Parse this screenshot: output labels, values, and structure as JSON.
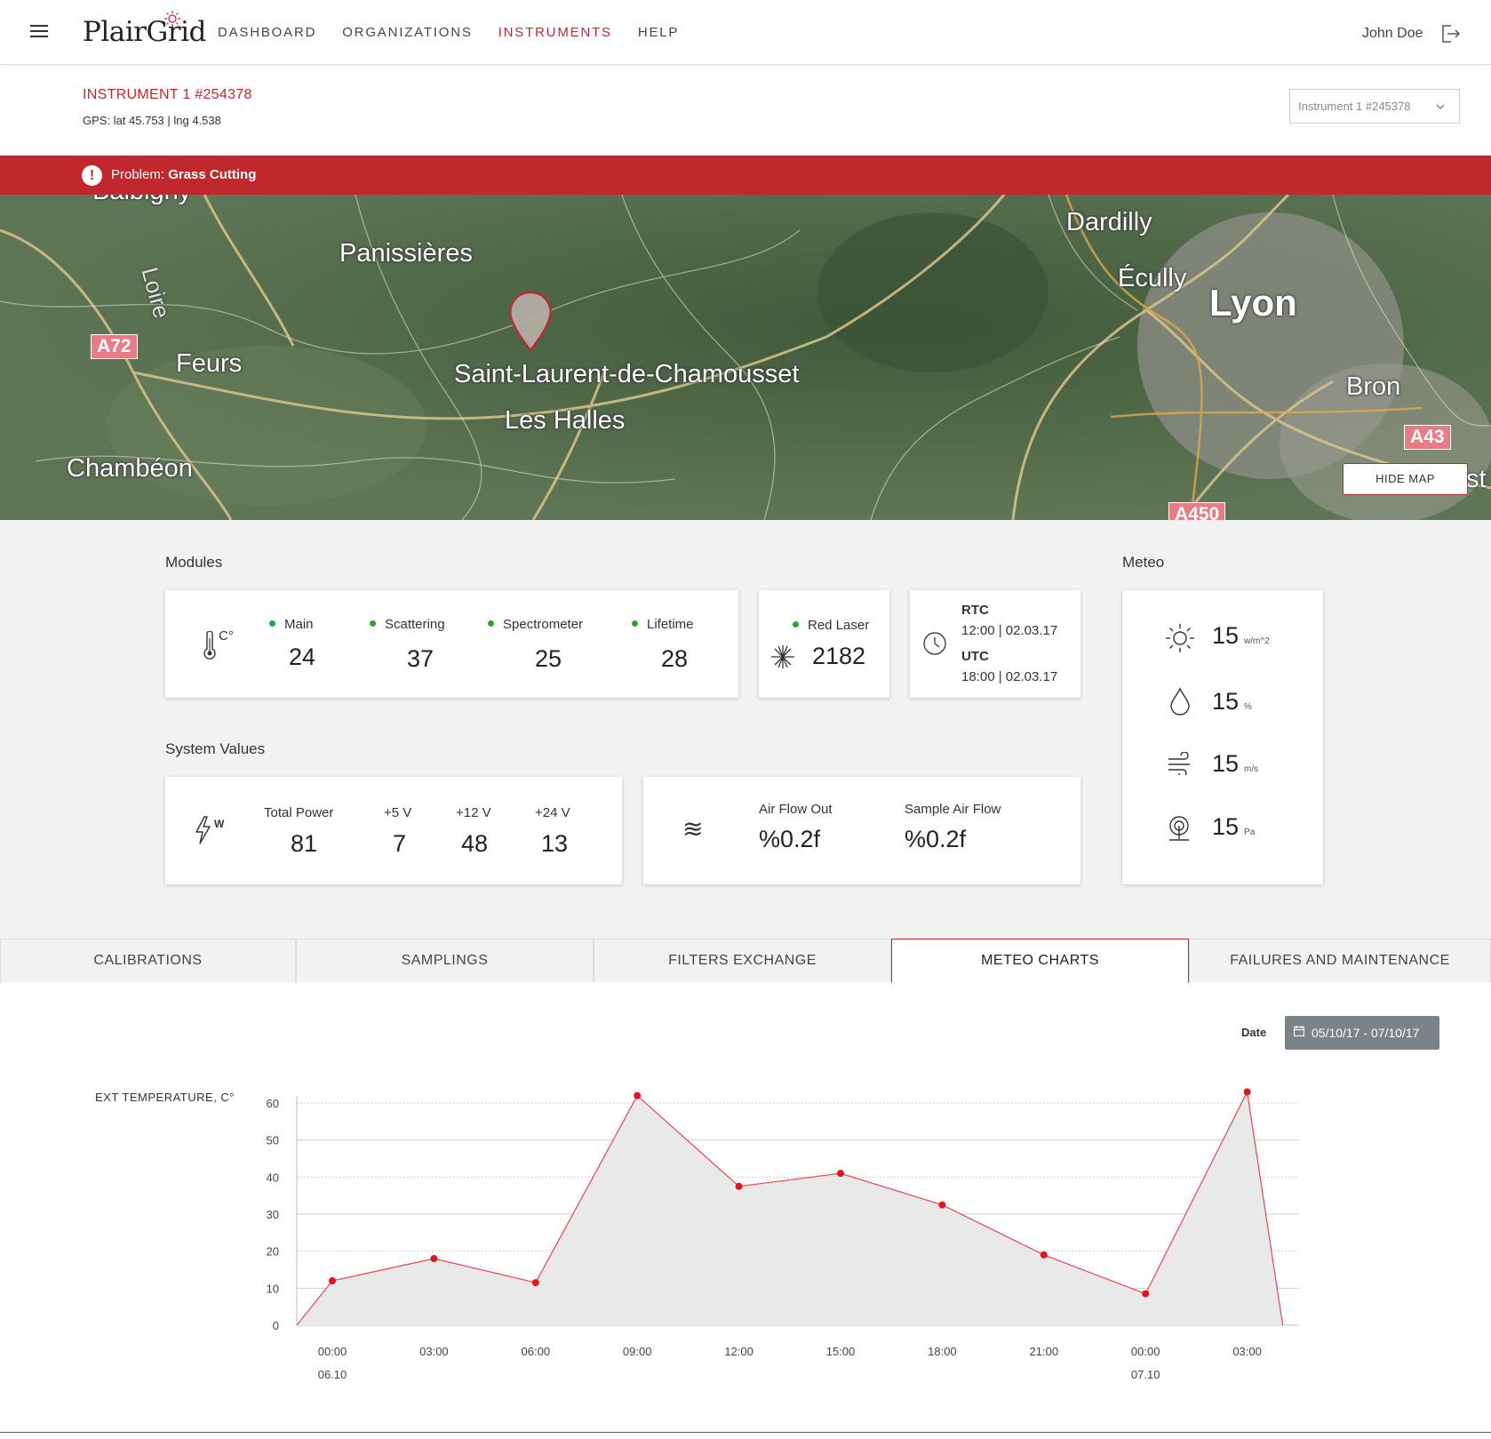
{
  "header": {
    "logo": "PlairGrid",
    "nav": [
      "DASHBOARD",
      "ORGANIZATIONS",
      "INSTRUMENTS",
      "HELP"
    ],
    "active_nav": "INSTRUMENTS",
    "user": "John Doe"
  },
  "instrument": {
    "title": "INSTRUMENT 1 #254378",
    "gps": "GPS: lat 45.753 | lng 4.538",
    "select_value": "Instrument 1 #245378"
  },
  "problem": {
    "prefix": "Problem:",
    "value": "Grass Cutting"
  },
  "map": {
    "labels": [
      "Balbigny",
      "Panissières",
      "Loire",
      "Feurs",
      "Saint-Laurent-de-Chamousset",
      "Les Halles",
      "Chambéon",
      "Dardilly",
      "Écully",
      "Lyon",
      "Bron",
      "st"
    ],
    "roads": [
      "A72",
      "A43",
      "A450"
    ],
    "hide_map": "HIDE MAP"
  },
  "modules": {
    "title": "Modules",
    "temp_unit": "C°",
    "items": [
      {
        "label": "Main",
        "value": "24"
      },
      {
        "label": "Scattering",
        "value": "37"
      },
      {
        "label": "Spectrometer",
        "value": "25"
      },
      {
        "label": "Lifetime",
        "value": "28"
      }
    ],
    "laser": {
      "label": "Red Laser",
      "value": "2182"
    },
    "rtc": {
      "label": "RTC",
      "value": "12:00 | 02.03.17"
    },
    "utc": {
      "label": "UTC",
      "value": "18:00 | 02.03.17"
    }
  },
  "system_values": {
    "title": "System Values",
    "power_unit": "W",
    "items": [
      {
        "label": "Total Power",
        "value": "81"
      },
      {
        "label": "+5 V",
        "value": "7"
      },
      {
        "label": "+12 V",
        "value": "48"
      },
      {
        "label": "+24 V",
        "value": "13"
      }
    ],
    "airflow": [
      {
        "label": "Air Flow Out",
        "value": "%0.2f"
      },
      {
        "label": "Sample Air Flow",
        "value": "%0.2f"
      }
    ]
  },
  "meteo": {
    "title": "Meteo",
    "items": [
      {
        "icon": "sun-icon",
        "value": "15",
        "unit": "w/m^2"
      },
      {
        "icon": "drop-icon",
        "value": "15",
        "unit": "%"
      },
      {
        "icon": "wind-icon",
        "value": "15",
        "unit": "m/s"
      },
      {
        "icon": "pressure-icon",
        "value": "15",
        "unit": "Pa"
      }
    ]
  },
  "tabs": [
    "CALIBRATIONS",
    "SAMPLINGS",
    "FILTERS EXCHANGE",
    "METEO CHARTS",
    "FAILURES AND MAINTENANCE"
  ],
  "active_tab": "METEO CHARTS",
  "date": {
    "label": "Date",
    "range": "05/10/17 - 07/10/17"
  },
  "chart_data": {
    "type": "area",
    "title": "EXT TEMPERATURE, C°",
    "x": [
      "00:00",
      "03:00",
      "06:00",
      "09:00",
      "12:00",
      "15:00",
      "18:00",
      "21:00",
      "00:00",
      "03:00"
    ],
    "x_sublabels": [
      "06.10",
      "",
      "",
      "",
      "",
      "",
      "",
      "",
      "07.10",
      ""
    ],
    "series": [
      {
        "values": [
          12,
          18,
          11.5,
          62,
          37.5,
          41,
          32.5,
          19,
          8.5,
          63
        ]
      }
    ],
    "ylim": [
      0,
      60
    ],
    "yticks": [
      0,
      10,
      20,
      30,
      40,
      50,
      60
    ],
    "grid": true,
    "colors": {
      "line": "#e8484f",
      "fill": "#e9e9e9",
      "point": "#e0141e"
    }
  }
}
